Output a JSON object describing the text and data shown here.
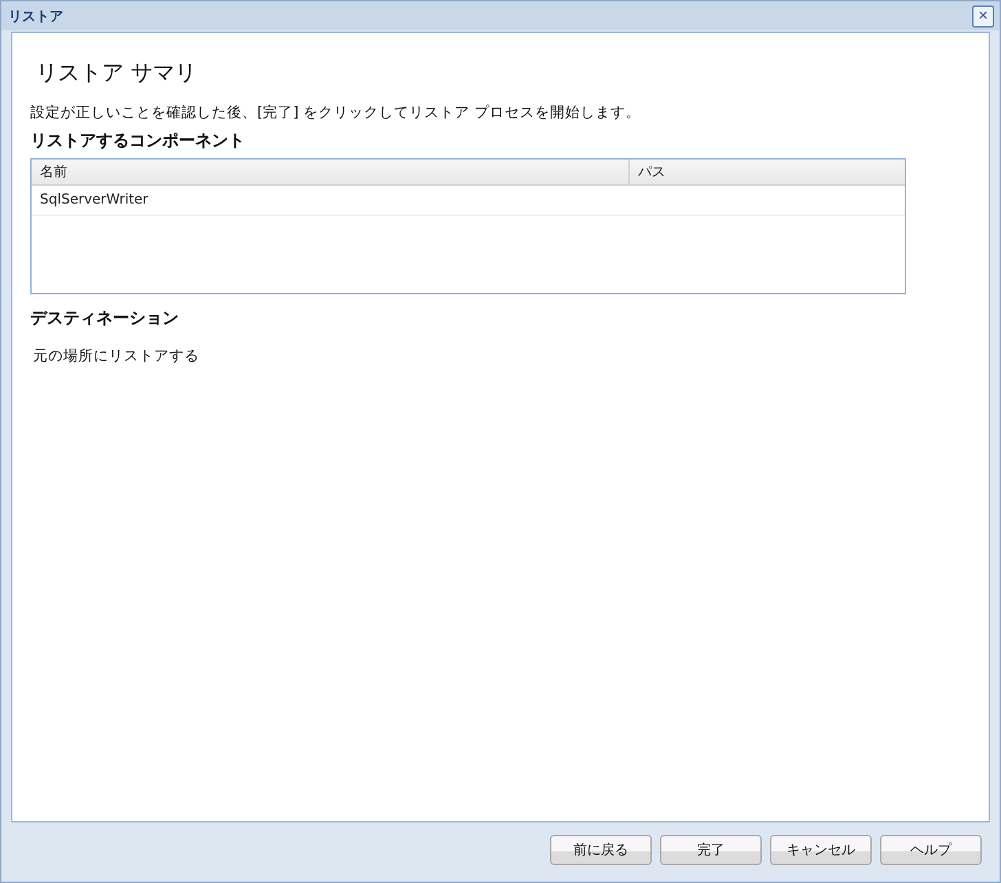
{
  "window": {
    "title": "リストア",
    "close": "×"
  },
  "heading": "リストア サマリ",
  "instruction": "設定が正しいことを確認した後、[完了] をクリックしてリストア プロセスを開始します。",
  "components_section": {
    "title": "リストアするコンポーネント",
    "table": {
      "columns": [
        "名前",
        "パス"
      ],
      "rows": [
        [
          "SqlServerWriter",
          ""
        ]
      ]
    }
  },
  "destination_section": {
    "title": "デスティネーション",
    "value": "元の場所にリストアする"
  },
  "buttons": [
    "前に戻る",
    "完了",
    "キャンセル",
    "ヘルプ"
  ]
}
